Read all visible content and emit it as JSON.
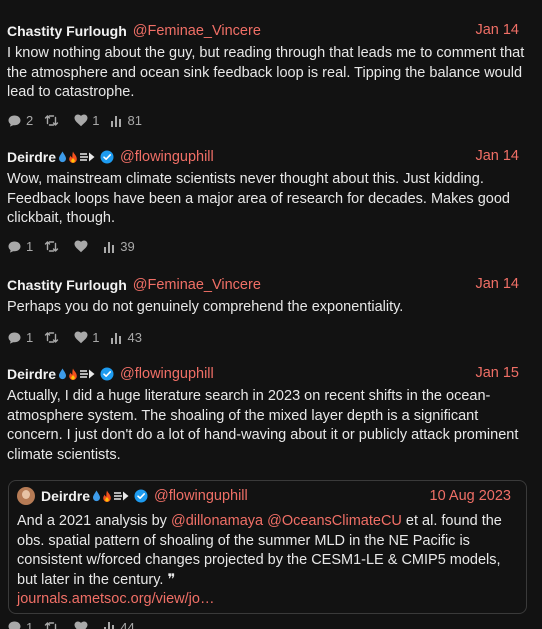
{
  "posts": [
    {
      "author": "Chastity Furlough",
      "handle": "@Feminae_Vincere",
      "date": "Jan 14",
      "body": "I know nothing about the guy, but reading through that leads me to comment that the atmosphere and ocean sink feedback loop is real. Tipping the balance would lead to catastrophe.",
      "replies": "2",
      "reposts": "",
      "likes": "1",
      "views": "81"
    },
    {
      "author": "Deirdre",
      "handle": "@flowinguphill",
      "date": "Jan 14",
      "body": "Wow, mainstream climate scientists never thought about this. Just kidding. Feedback loops have been a major area of research for decades. Makes good clickbait, though.",
      "replies": "1",
      "reposts": "",
      "likes": "",
      "views": "39"
    },
    {
      "author": "Chastity Furlough",
      "handle": "@Feminae_Vincere",
      "date": "Jan 14",
      "body": "Perhaps you do not genuinely comprehend the exponentiality.",
      "replies": "1",
      "reposts": "",
      "likes": "1",
      "views": "43"
    },
    {
      "author": "Deirdre",
      "handle": "@flowinguphill",
      "date": "Jan 15",
      "body": "Actually, I did a huge literature search in 2023 on recent shifts in the ocean-atmosphere system. The shoaling of the mixed layer depth is a significant concern.  I just don't do a lot of hand-waving about it or publicly attack prominent climate scientists.",
      "replies": "1",
      "reposts": "",
      "likes": "",
      "views": "44"
    }
  ],
  "quote": {
    "author": "Deirdre",
    "handle": "@flowinguphill",
    "date": "10 Aug 2023",
    "text_1": "And a 2021 analysis by ",
    "mention_1": "@dillonamaya",
    "mention_2": "@OceansClimateCU",
    "text_2": " et al. found the obs. spatial pattern of shoaling of the summer MLD in the NE Pacific is consistent w/forced changes projected by the CESM1-LE & CMIP5 models, but later in the century. ",
    "quote_mark": "❞",
    "link": "journals.ametsoc.org/view/jo…"
  },
  "colors": {
    "background": "#121212",
    "text": "#e8e8e8",
    "accent": "#f06f66",
    "muted": "#a9a9a9",
    "verified": "#1d9bf0"
  },
  "icons": [
    "reply-icon",
    "repost-icon",
    "like-icon",
    "views-icon",
    "water-drop-icon",
    "fire-icon",
    "arrow-icon",
    "verified-badge-icon"
  ]
}
